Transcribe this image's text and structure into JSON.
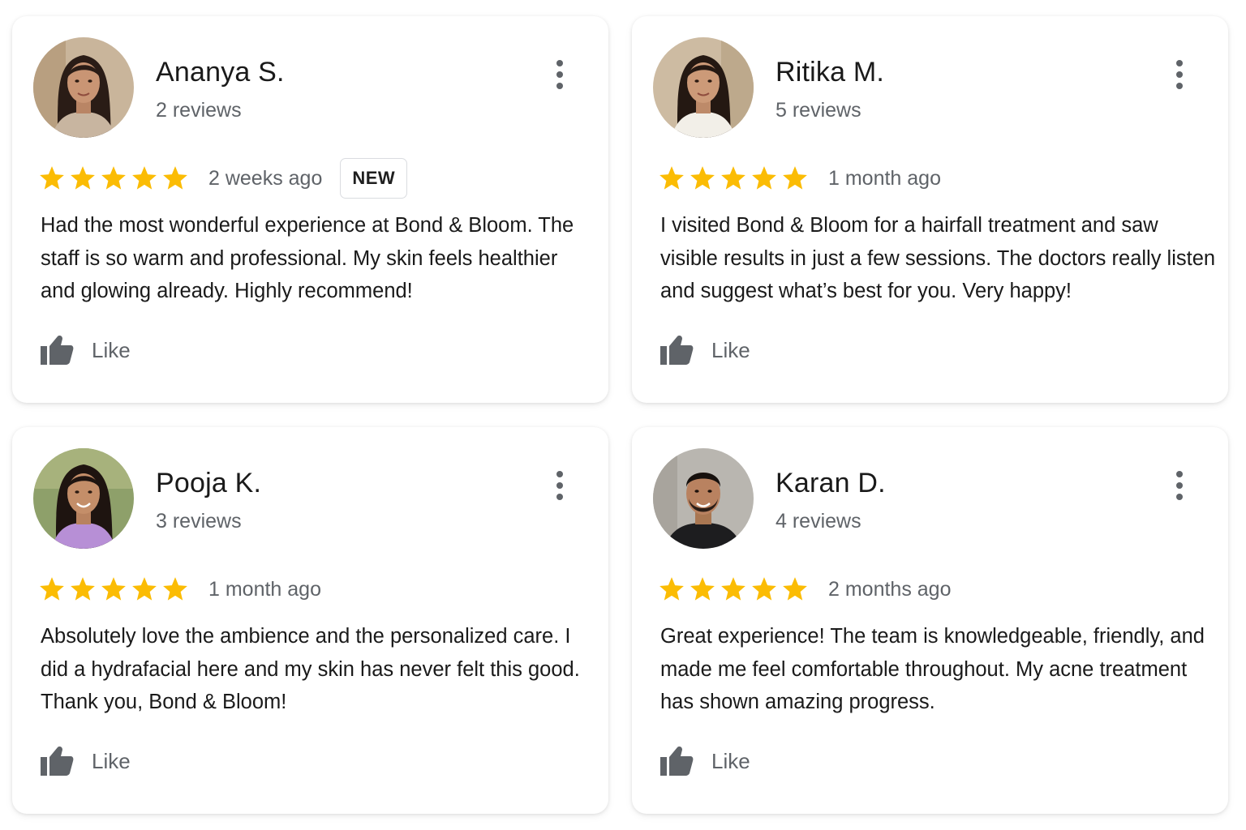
{
  "accent": {
    "star": "#FBBC04",
    "text_secondary": "#5f6368",
    "icon": "#5f6368"
  },
  "reviews": [
    {
      "name": "Ananya S.",
      "review_count": "2 reviews",
      "rating": 5,
      "time": "2 weeks ago",
      "badge": "NEW",
      "text": "Had the most wonderful experience at Bond & Bloom. The staff is so warm and professional. My skin feels healthier and glowing already. Highly recommend!",
      "like_label": "Like",
      "menu_icon": "more-vert-icon",
      "like_icon": "thumbs-up-icon"
    },
    {
      "name": "Ritika M.",
      "review_count": "5 reviews",
      "rating": 5,
      "time": "1 month ago",
      "text": "I visited Bond & Bloom for a hairfall treatment and saw visible results in just a few sessions. The doctors really listen and suggest what’s best for you. Very happy!",
      "like_label": "Like",
      "menu_icon": "more-vert-icon",
      "like_icon": "thumbs-up-icon"
    },
    {
      "name": "Pooja K.",
      "review_count": "3 reviews",
      "rating": 5,
      "time": "1 month ago",
      "text": "Absolutely love the ambience and the personalized care. I did a hydrafacial here and my skin has never felt this good. Thank you, Bond & Bloom!",
      "like_label": "Like",
      "menu_icon": "more-vert-icon",
      "like_icon": "thumbs-up-icon"
    },
    {
      "name": "Karan D.",
      "review_count": "4 reviews",
      "rating": 5,
      "time": "2 months ago",
      "text": "Great experience! The team is knowledgeable, friendly, and made me feel comfortable throughout. My acne treatment has shown amazing progress.",
      "like_label": "Like",
      "menu_icon": "more-vert-icon",
      "like_icon": "thumbs-up-icon"
    }
  ]
}
